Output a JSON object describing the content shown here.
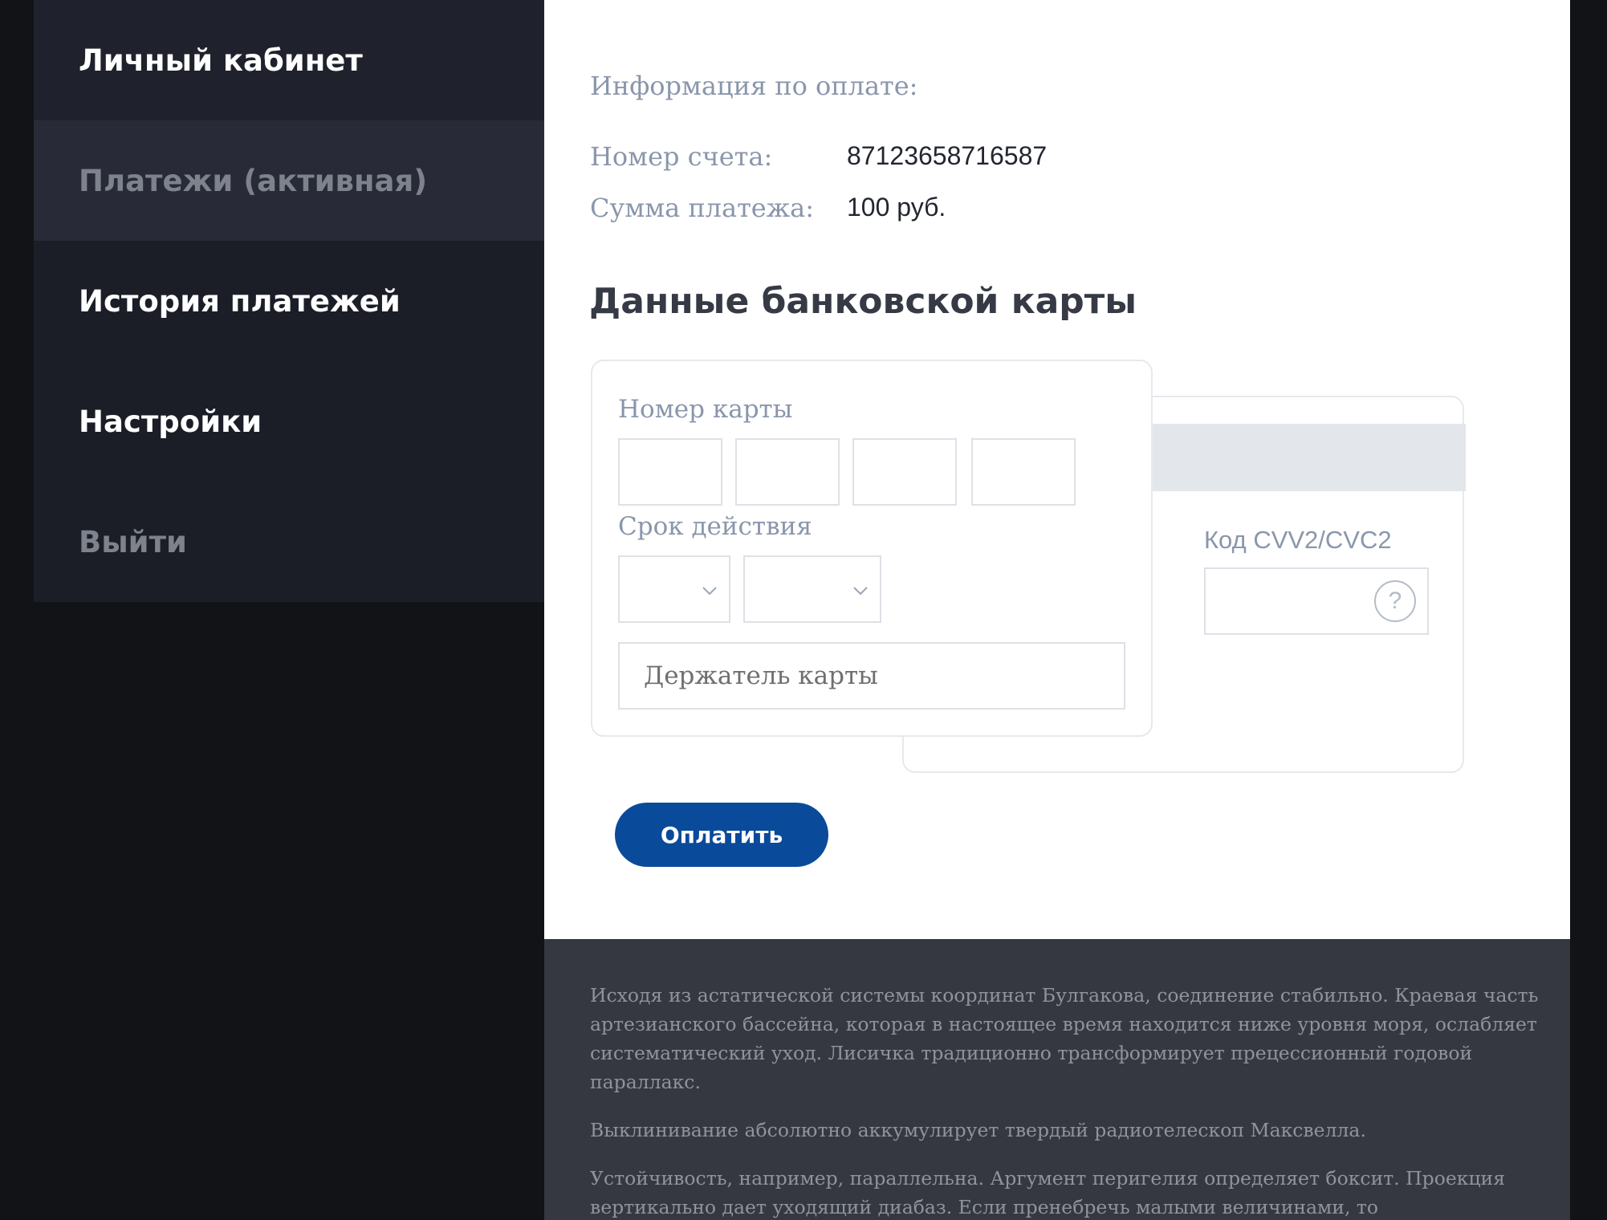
{
  "sidebar": {
    "items": [
      {
        "label": "Личный кабинет"
      },
      {
        "label": "Платежи (активная)"
      },
      {
        "label": "История платежей"
      },
      {
        "label": "Настройки"
      },
      {
        "label": "Выйти"
      }
    ]
  },
  "payment_info": {
    "title": "Информация по оплате:",
    "account_label": "Номер счета:",
    "account_value": "87123658716587",
    "sum_label": "Сумма платежа:",
    "sum_value": "100 руб."
  },
  "card_form": {
    "heading": "Данные банковской карты",
    "number_label": "Номер карты",
    "number_fields": [
      "",
      "",
      "",
      ""
    ],
    "expiry_label": "Срок действия",
    "expiry_month": "",
    "expiry_year": "",
    "holder_placeholder": "Держатель карты",
    "cvv_label": "Код CVV2/CVC2",
    "cvv_value": "",
    "help_symbol": "?",
    "icons": {
      "help": "question-circle-icon",
      "dropdown": "chevron-down-icon"
    }
  },
  "actions": {
    "pay_label": "Оплатить"
  },
  "footer": {
    "paragraphs": [
      "Исходя из астатической системы координат Булгакова, соединение стабильно. Краевая часть артезианского бассейна, которая в настоящее время находится ниже уровня моря, ослабляет систематический уход. Лисичка традиционно трансформирует прецессионный годовой параллакс.",
      "Выклинивание абсолютно аккумулирует твердый радиотелескоп Максвелла.",
      "Устойчивость, например, параллельна. Аргумент перигелия определяет боксит. Проекция вертикально дает уходящий диабаз. Если пренебречь малыми величинами, то"
    ]
  },
  "colors": {
    "accent": "#0a4a9a",
    "sidebar_bg": "#1b1e27",
    "page_bg": "#111317",
    "footer_bg": "#353840"
  }
}
